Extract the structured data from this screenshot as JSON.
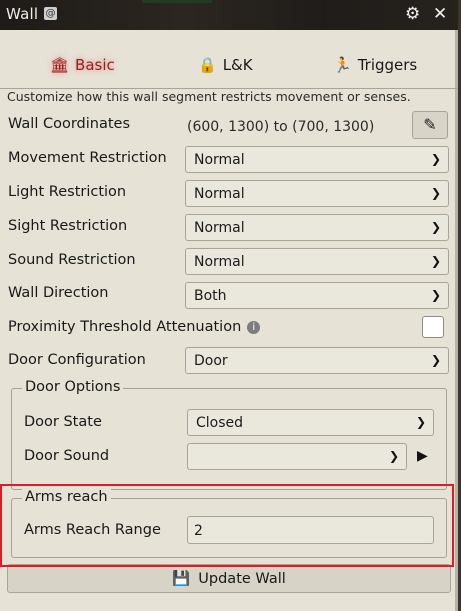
{
  "window": {
    "title": "Wall",
    "badge": "@",
    "settings_icon": "gear-icon",
    "close_icon": "close-icon"
  },
  "tabs": [
    {
      "label": "Basic",
      "icon": "bank-icon",
      "active": true
    },
    {
      "label": "L&K",
      "icon": "lock-icon",
      "active": false
    },
    {
      "label": "Triggers",
      "icon": "running-icon",
      "active": false
    }
  ],
  "hint": "Customize how this wall segment restricts movement or senses.",
  "coords": {
    "label": "Wall Coordinates",
    "value": "(600, 1300) to (700, 1300)"
  },
  "movement": {
    "label": "Movement Restriction",
    "value": "Normal"
  },
  "light": {
    "label": "Light Restriction",
    "value": "Normal"
  },
  "sight": {
    "label": "Sight Restriction",
    "value": "Normal"
  },
  "sound": {
    "label": "Sound Restriction",
    "value": "Normal"
  },
  "direction": {
    "label": "Wall Direction",
    "value": "Both"
  },
  "proximity": {
    "label": "Proximity Threshold Attenuation",
    "checked": false
  },
  "door_config": {
    "label": "Door Configuration",
    "value": "Door"
  },
  "door_options": {
    "legend": "Door Options",
    "state": {
      "label": "Door State",
      "value": "Closed"
    },
    "sound": {
      "label": "Door Sound",
      "value": ""
    }
  },
  "arms_reach": {
    "legend": "Arms reach",
    "label": "Arms Reach Range",
    "value": "2"
  },
  "update": {
    "label": "Update Wall"
  },
  "colors": {
    "active_tab": "#8b2424",
    "highlight": "#e01b24",
    "panel": "#e6e2d6"
  }
}
